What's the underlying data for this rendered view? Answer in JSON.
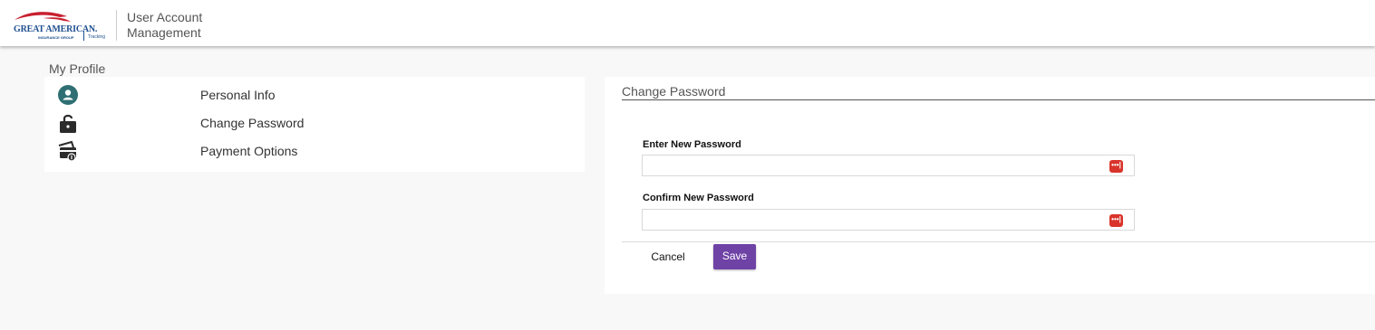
{
  "header": {
    "logo_text": "GREAT AMERICAN.",
    "logo_sub": "INSURANCE GROUP",
    "logo_tracking": "Tracking",
    "app_title": "User Account Management"
  },
  "profile": {
    "title": "My Profile",
    "items": [
      {
        "label": "Personal Info",
        "icon": "user-circle-icon"
      },
      {
        "label": "Change Password",
        "icon": "lock-open-icon"
      },
      {
        "label": "Payment Options",
        "icon": "payment-card-icon"
      }
    ]
  },
  "change_password": {
    "title": "Change Password",
    "new_password_label": "Enter New Password",
    "new_password_value": "",
    "confirm_password_label": "Confirm New Password",
    "confirm_password_value": "",
    "password_manager_glyph": "•••|",
    "cancel_label": "Cancel",
    "save_label": "Save"
  },
  "colors": {
    "accent": "#6f42a6",
    "brand_red": "#c8202f",
    "brand_blue": "#1e4f8f",
    "icon_teal": "#2f6f73"
  }
}
